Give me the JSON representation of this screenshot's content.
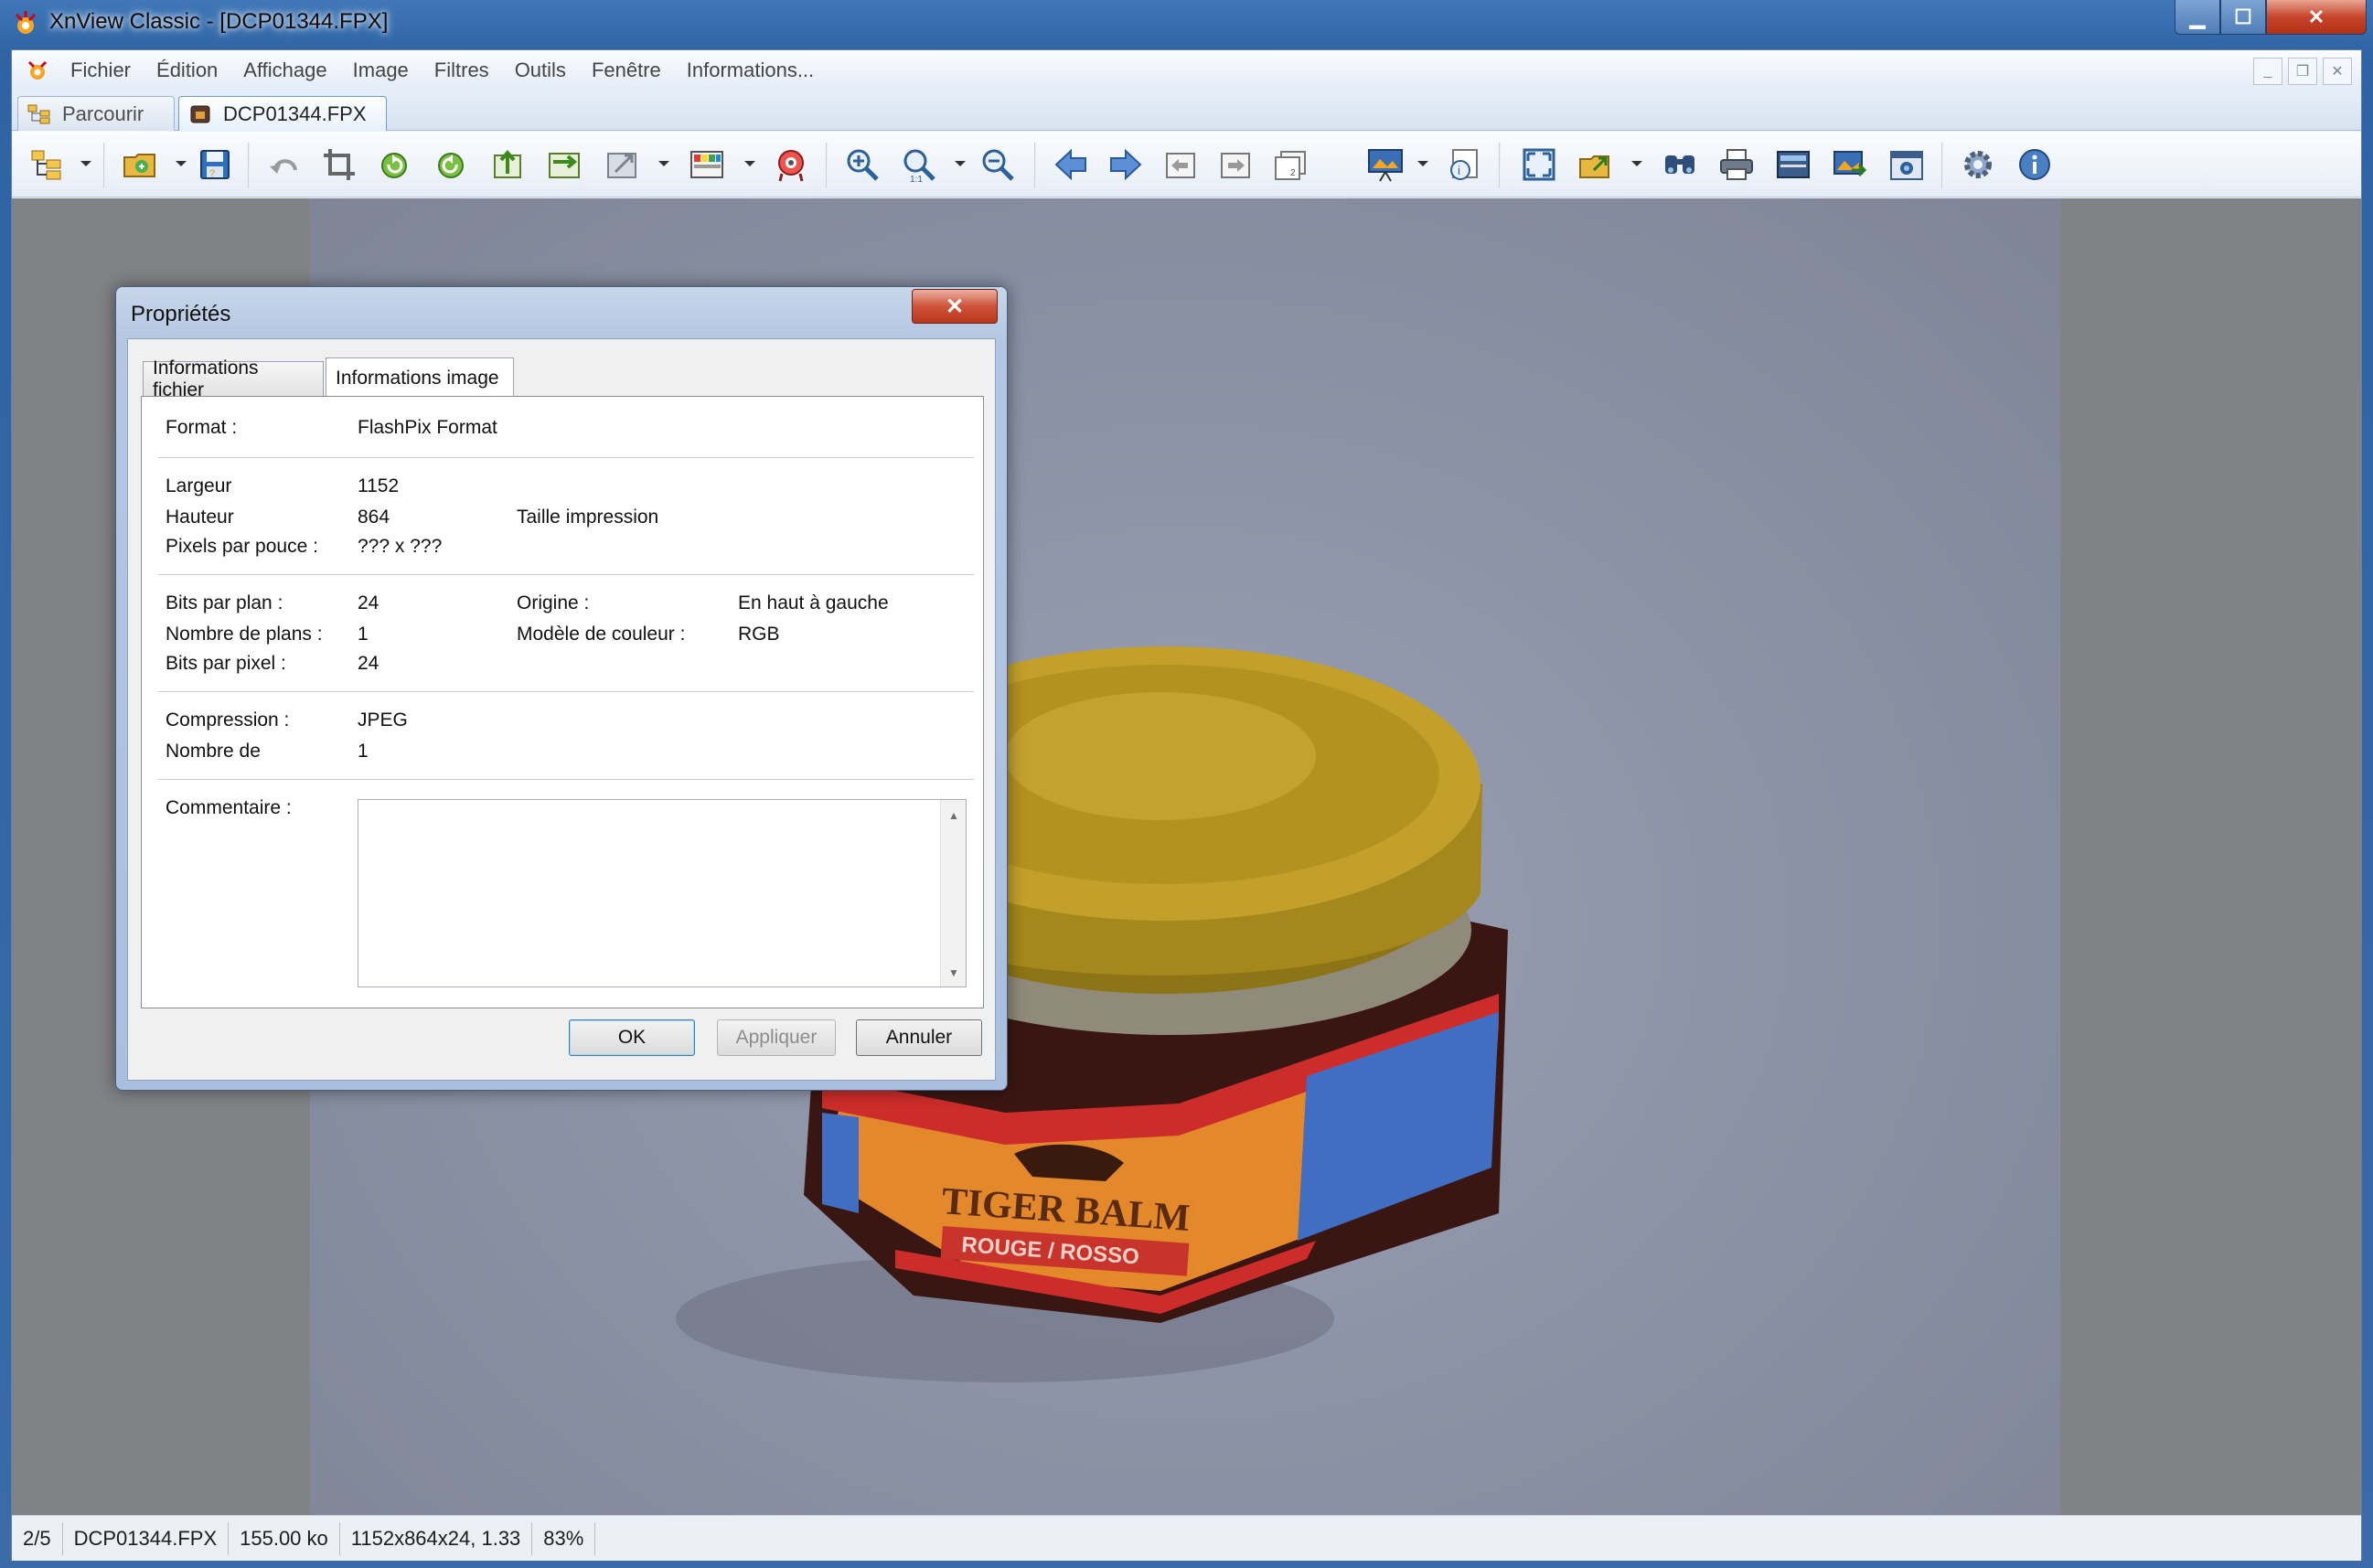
{
  "window": {
    "title": "XnView Classic - [DCP01344.FPX]"
  },
  "menu": {
    "items": [
      "Fichier",
      "Édition",
      "Affichage",
      "Image",
      "Filtres",
      "Outils",
      "Fenêtre",
      "Informations..."
    ]
  },
  "tabs": [
    {
      "label": "Parcourir"
    },
    {
      "label": "DCP01344.FPX"
    }
  ],
  "toolbar": {
    "icons": [
      "browser-tree-icon",
      "open-folder-icon",
      "save-icon",
      "undo-icon",
      "crop-icon",
      "rotate-left-icon",
      "rotate-right-icon",
      "export-icon",
      "convert-icon",
      "resize-icon",
      "adjust-colors-icon",
      "red-eye-icon",
      "zoom-in-icon",
      "zoom-1to1-icon",
      "zoom-out-icon",
      "previous-arrow-icon",
      "next-arrow-icon",
      "first-image-icon",
      "last-image-icon",
      "page-icon",
      "slideshow-icon",
      "info-icon",
      "fit-screen-icon",
      "open-with-icon",
      "find-icon",
      "print-icon",
      "scan-icon",
      "wallpaper-icon",
      "capture-icon",
      "settings-icon",
      "about-icon"
    ]
  },
  "status": {
    "position": "2/5",
    "filename": "DCP01344.FPX",
    "size": "155.00 ko",
    "dimensions": "1152x864x24, 1.33",
    "zoom": "83%"
  },
  "dialog": {
    "title": "Propriétés",
    "close": "✕",
    "tabs": [
      "Informations fichier",
      "Informations image"
    ],
    "format_label": "Format :",
    "format_value": "FlashPix Format",
    "width_label": "Largeur",
    "width_value": "1152",
    "height_label": "Hauteur",
    "height_value": "864",
    "print_size_label": "Taille impression",
    "ppi_label": "Pixels par pouce :",
    "ppi_value": "??? x ???",
    "bpp_plane_label": "Bits par plan :",
    "bpp_plane_value": "24",
    "origin_label": "Origine :",
    "origin_value": "En haut à gauche",
    "planes_label": "Nombre de plans :",
    "planes_value": "1",
    "color_model_label": "Modèle de couleur :",
    "color_model_value": "RGB",
    "bpp_label": "Bits par pixel :",
    "bpp_value": "24",
    "compression_label": "Compression :",
    "compression_value": "JPEG",
    "count_label": "Nombre de",
    "count_value": "1",
    "comment_label": "Commentaire :",
    "buttons": {
      "ok": "OK",
      "apply": "Appliquer",
      "cancel": "Annuler"
    }
  },
  "photo": {
    "jar_label_line1": "TIGER BALM",
    "jar_label_line2": "ROUGE / ROSSO"
  }
}
